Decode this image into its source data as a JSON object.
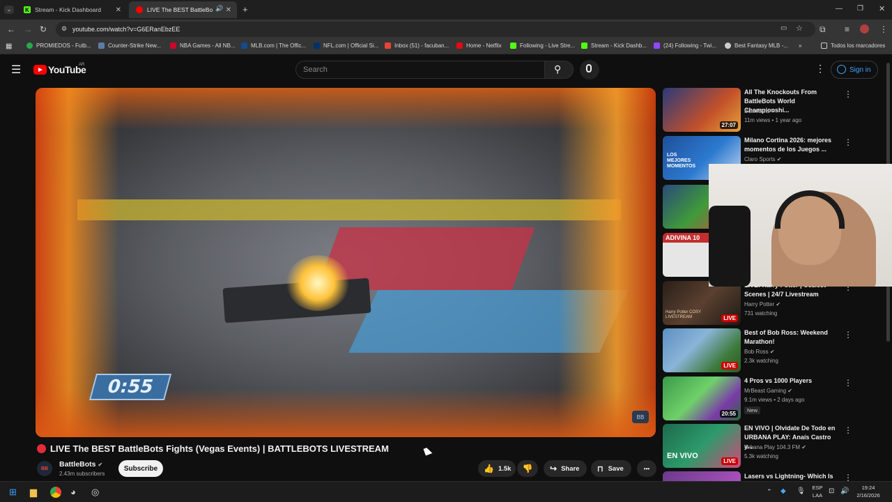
{
  "browser": {
    "tabs": [
      {
        "label": "Stream - Kick Dashboard",
        "fav": "K",
        "color": "#53fc18",
        "active": false
      },
      {
        "label": "LIVE The BEST BattleBo",
        "fav": "●",
        "color": "#ff0000",
        "active": true
      }
    ],
    "new_tab": "+",
    "url": "youtube.com/watch?v=G6ERanEbzEE",
    "bookmarks": [
      {
        "label": "PROMIEDOS - Futb...",
        "color": "#2aa84a"
      },
      {
        "label": "Counter-Strike New...",
        "color": "#5b7ca8"
      },
      {
        "label": "NBA Games - All NB...",
        "color": "#c9082a"
      },
      {
        "label": "MLB.com | The Offic...",
        "color": "#134a8e"
      },
      {
        "label": "NFL.com | Official Si...",
        "color": "#013369"
      },
      {
        "label": "Inbox (51) - facuban...",
        "color": "#ea4335"
      },
      {
        "label": "Home - Netflix",
        "color": "#e50914"
      },
      {
        "label": "Following - Live Stre...",
        "color": "#53fc18"
      },
      {
        "label": "Stream - Kick Dashb...",
        "color": "#53fc18"
      },
      {
        "label": "(24) Following - Twi...",
        "color": "#9146ff"
      },
      {
        "label": "Best Fantasy MLB -...",
        "color": "#cccccc"
      }
    ],
    "bookmarks_more": "»",
    "all_bookmarks": "Todos los marcadores"
  },
  "youtube": {
    "logo_text": "YouTube",
    "region": "AR",
    "search_placeholder": "Search",
    "sign_in": "Sign in",
    "video": {
      "timer": "0:55",
      "watermark": "BB",
      "title": "LIVE The BEST BattleBots Fights (Vegas Events) | BATTLEBOTS LIVESTREAM",
      "channel": "BattleBots",
      "channel_avatar": "BB",
      "subscribers": "2.43m subscribers",
      "subscribe": "Subscribe",
      "likes": "1.5k",
      "share": "Share",
      "save": "Save",
      "more": "•••"
    },
    "recommendations": [
      {
        "title": "All The Knockouts From BattleBots World Championshi...",
        "channel": "BattleBots",
        "meta": "11m views • 1 year ago",
        "badge": "27:07",
        "badge_type": "dur",
        "thumb": "#7a2a2a"
      },
      {
        "title": "Milano Cortina 2026: mejores momentos de los Juegos ...",
        "channel": "Claro Sports",
        "meta": "",
        "badge": "",
        "badge_type": "",
        "thumb": "#1f4f9a",
        "thumb_text": "LOS MEJORES MOMENTOS"
      },
      {
        "title": "",
        "channel": "",
        "meta": "",
        "badge": "",
        "badge_type": "",
        "thumb": "#3f7f3a"
      },
      {
        "title": "",
        "channel": "",
        "meta": "",
        "badge": "",
        "badge_type": "",
        "thumb": "#c32f2f",
        "thumb_text": "ADIVINA 10"
      },
      {
        "title": "LIVE: Harry Potter | Coziest Scenes | 24/7 Livestream",
        "channel": "Harry Potter",
        "meta": "731 watching",
        "badge": "LIVE",
        "badge_type": "live",
        "thumb": "#4a3a2a",
        "thumb_text": "Harry Potter COSY LIVESTREAM"
      },
      {
        "title": "Best of Bob Ross: Weekend Marathon!",
        "channel": "Bob Ross",
        "meta": "2.3k watching",
        "badge": "LIVE",
        "badge_type": "live",
        "thumb": "#5c8fc2"
      },
      {
        "title": "4 Pros vs 1000 Players",
        "channel": "MrBeast Gaming",
        "meta": "9.1m views • 2 days ago",
        "badge": "20:55",
        "badge_type": "dur",
        "new": "New",
        "thumb": "#3a9a4a"
      },
      {
        "title": "EN VIVO | Olvidate De Todo en URBANA PLAY: Anaís Castro y...",
        "channel": "Urbana Play 104.3 FM",
        "meta": "5.3k watching",
        "badge": "LIVE",
        "badge_type": "live",
        "thumb": "#1e6a4e",
        "thumb_text": "EN VIVO"
      },
      {
        "title": "Lasers vs Lightning- Which Is",
        "channel": "",
        "meta": "",
        "badge": "",
        "badge_type": "",
        "thumb": "#6a3a8a"
      }
    ]
  },
  "taskbar": {
    "lang_top": "ESP",
    "lang_bottom": "LAA",
    "time": "19:24",
    "date": "2/16/2026"
  }
}
